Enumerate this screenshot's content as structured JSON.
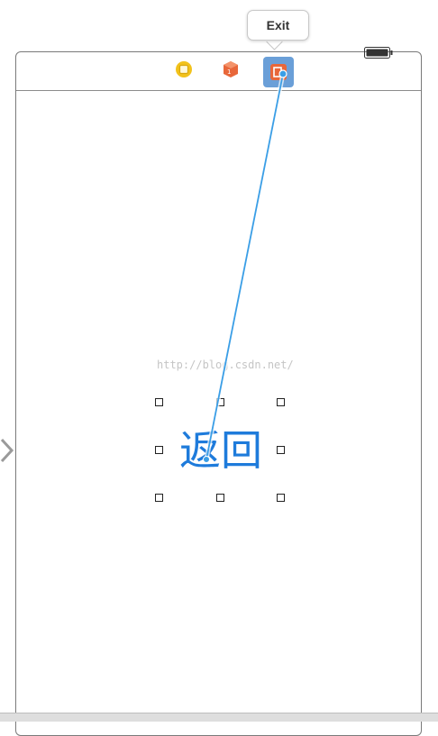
{
  "tooltip": {
    "exit_label": "Exit"
  },
  "dock": {
    "items": [
      {
        "icon": "view-controller-icon",
        "color": "#f2c21b"
      },
      {
        "icon": "first-responder-icon",
        "color": "#e8673a"
      },
      {
        "icon": "exit-icon",
        "color": "#e8673a",
        "selected_bg": "#6a9fd8"
      }
    ]
  },
  "scene": {
    "watermark": "http://blog.csdn.net/",
    "button_label": "返回",
    "button_color": "#1e7bdb"
  }
}
